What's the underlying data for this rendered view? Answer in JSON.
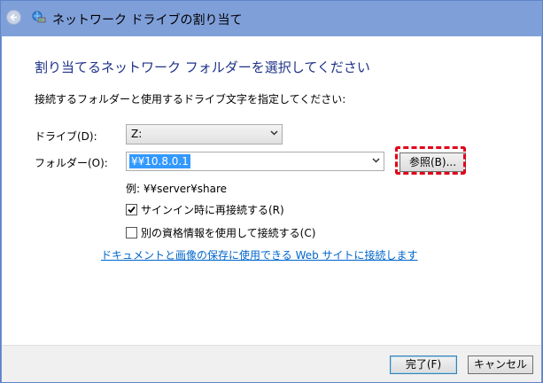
{
  "window": {
    "title": "ネットワーク ドライブの割り当て",
    "icons": {
      "back": "back-arrow-icon",
      "network": "network-drive-icon"
    }
  },
  "main": {
    "heading": "割り当てるネットワーク フォルダーを選択してください",
    "instruction": "接続するフォルダーと使用するドライブ文字を指定してください:",
    "drive": {
      "label": "ドライブ(D):",
      "value": "Z:"
    },
    "folder": {
      "label": "フォルダー(O):",
      "value": "¥¥10.8.0.1"
    },
    "browse_label": "参照(B)...",
    "example": "例: ¥¥server¥share",
    "reconnect": {
      "label": "サインイン時に再接続する(R)",
      "checked": true
    },
    "other_credentials": {
      "label": "別の資格情報を使用して接続する(C)",
      "checked": false
    },
    "link": "ドキュメントと画像の保存に使用できる Web サイトに接続します"
  },
  "footer": {
    "finish_label": "完了(F)",
    "cancel_label": "キャンセル"
  },
  "colors": {
    "heading": "#1e3287",
    "link": "#0066cc",
    "selection": "#3399ff",
    "highlight_dash": "#e2001a"
  }
}
